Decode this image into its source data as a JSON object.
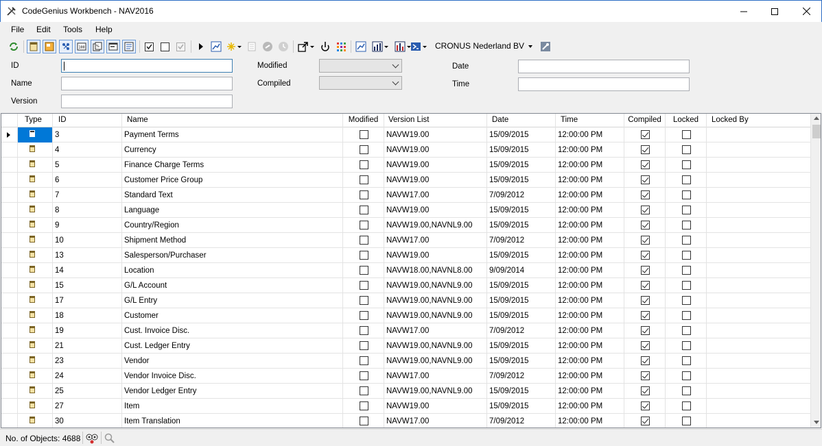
{
  "window": {
    "title": "CodeGenius Workbench - NAV2016"
  },
  "menu": [
    "File",
    "Edit",
    "Tools",
    "Help"
  ],
  "toolbar": {
    "company": "CRONUS Nederland BV",
    "icons": [
      "refresh-icon",
      "table-icon",
      "page-icon",
      "report-icon",
      "codeunit-icon",
      "xmlport-icon",
      "query-icon",
      "menusuite-icon",
      "check-all-icon",
      "uncheck-icon",
      "check-disabled-icon",
      "run-icon",
      "design-icon",
      "new-icon",
      "document-icon",
      "link-icon",
      "history-icon",
      "export-icon",
      "power-icon",
      "grid-apps-icon",
      "chart-icon",
      "chart-dark-icon",
      "chart-red-icon",
      "powershell-icon",
      "connect-icon"
    ]
  },
  "filter": {
    "id_label": "ID",
    "name_label": "Name",
    "version_label": "Version",
    "modified_label": "Modified",
    "compiled_label": "Compiled",
    "date_label": "Date",
    "time_label": "Time",
    "id_value": "",
    "name_value": "",
    "version_value": "",
    "date_value": "",
    "time_value": ""
  },
  "grid": {
    "headers": {
      "type": "Type",
      "id": "ID",
      "name": "Name",
      "modified": "Modified",
      "version_list": "Version List",
      "date": "Date",
      "time": "Time",
      "compiled": "Compiled",
      "locked": "Locked",
      "locked_by": "Locked By"
    },
    "rows": [
      {
        "id": "3",
        "name": "Payment Terms",
        "modified": false,
        "version": "NAVW19.00",
        "date": "15/09/2015",
        "time": "12:00:00 PM",
        "compiled": true,
        "locked": false,
        "locked_by": "",
        "selected": true
      },
      {
        "id": "4",
        "name": "Currency",
        "modified": false,
        "version": "NAVW19.00",
        "date": "15/09/2015",
        "time": "12:00:00 PM",
        "compiled": true,
        "locked": false,
        "locked_by": ""
      },
      {
        "id": "5",
        "name": "Finance Charge Terms",
        "modified": false,
        "version": "NAVW19.00",
        "date": "15/09/2015",
        "time": "12:00:00 PM",
        "compiled": true,
        "locked": false,
        "locked_by": ""
      },
      {
        "id": "6",
        "name": "Customer Price Group",
        "modified": false,
        "version": "NAVW19.00",
        "date": "15/09/2015",
        "time": "12:00:00 PM",
        "compiled": true,
        "locked": false,
        "locked_by": ""
      },
      {
        "id": "7",
        "name": "Standard Text",
        "modified": false,
        "version": "NAVW17.00",
        "date": "7/09/2012",
        "time": "12:00:00 PM",
        "compiled": true,
        "locked": false,
        "locked_by": ""
      },
      {
        "id": "8",
        "name": "Language",
        "modified": false,
        "version": "NAVW19.00",
        "date": "15/09/2015",
        "time": "12:00:00 PM",
        "compiled": true,
        "locked": false,
        "locked_by": ""
      },
      {
        "id": "9",
        "name": "Country/Region",
        "modified": false,
        "version": "NAVW19.00,NAVNL9.00",
        "date": "15/09/2015",
        "time": "12:00:00 PM",
        "compiled": true,
        "locked": false,
        "locked_by": ""
      },
      {
        "id": "10",
        "name": "Shipment Method",
        "modified": false,
        "version": "NAVW17.00",
        "date": "7/09/2012",
        "time": "12:00:00 PM",
        "compiled": true,
        "locked": false,
        "locked_by": ""
      },
      {
        "id": "13",
        "name": "Salesperson/Purchaser",
        "modified": false,
        "version": "NAVW19.00",
        "date": "15/09/2015",
        "time": "12:00:00 PM",
        "compiled": true,
        "locked": false,
        "locked_by": ""
      },
      {
        "id": "14",
        "name": "Location",
        "modified": false,
        "version": "NAVW18.00,NAVNL8.00",
        "date": "9/09/2014",
        "time": "12:00:00 PM",
        "compiled": true,
        "locked": false,
        "locked_by": ""
      },
      {
        "id": "15",
        "name": "G/L Account",
        "modified": false,
        "version": "NAVW19.00,NAVNL9.00",
        "date": "15/09/2015",
        "time": "12:00:00 PM",
        "compiled": true,
        "locked": false,
        "locked_by": ""
      },
      {
        "id": "17",
        "name": "G/L Entry",
        "modified": false,
        "version": "NAVW19.00,NAVNL9.00",
        "date": "15/09/2015",
        "time": "12:00:00 PM",
        "compiled": true,
        "locked": false,
        "locked_by": ""
      },
      {
        "id": "18",
        "name": "Customer",
        "modified": false,
        "version": "NAVW19.00,NAVNL9.00",
        "date": "15/09/2015",
        "time": "12:00:00 PM",
        "compiled": true,
        "locked": false,
        "locked_by": ""
      },
      {
        "id": "19",
        "name": "Cust. Invoice Disc.",
        "modified": false,
        "version": "NAVW17.00",
        "date": "7/09/2012",
        "time": "12:00:00 PM",
        "compiled": true,
        "locked": false,
        "locked_by": ""
      },
      {
        "id": "21",
        "name": "Cust. Ledger Entry",
        "modified": false,
        "version": "NAVW19.00,NAVNL9.00",
        "date": "15/09/2015",
        "time": "12:00:00 PM",
        "compiled": true,
        "locked": false,
        "locked_by": ""
      },
      {
        "id": "23",
        "name": "Vendor",
        "modified": false,
        "version": "NAVW19.00,NAVNL9.00",
        "date": "15/09/2015",
        "time": "12:00:00 PM",
        "compiled": true,
        "locked": false,
        "locked_by": ""
      },
      {
        "id": "24",
        "name": "Vendor Invoice Disc.",
        "modified": false,
        "version": "NAVW17.00",
        "date": "7/09/2012",
        "time": "12:00:00 PM",
        "compiled": true,
        "locked": false,
        "locked_by": ""
      },
      {
        "id": "25",
        "name": "Vendor Ledger Entry",
        "modified": false,
        "version": "NAVW19.00,NAVNL9.00",
        "date": "15/09/2015",
        "time": "12:00:00 PM",
        "compiled": true,
        "locked": false,
        "locked_by": ""
      },
      {
        "id": "27",
        "name": "Item",
        "modified": false,
        "version": "NAVW19.00",
        "date": "15/09/2015",
        "time": "12:00:00 PM",
        "compiled": true,
        "locked": false,
        "locked_by": ""
      },
      {
        "id": "30",
        "name": "Item Translation",
        "modified": false,
        "version": "NAVW17.00",
        "date": "7/09/2012",
        "time": "12:00:00 PM",
        "compiled": true,
        "locked": false,
        "locked_by": ""
      }
    ]
  },
  "status": {
    "objects_text": "No. of Objects: 4688"
  },
  "colors": {
    "accent": "#0078d7",
    "window_border": "#2b6cc4"
  }
}
